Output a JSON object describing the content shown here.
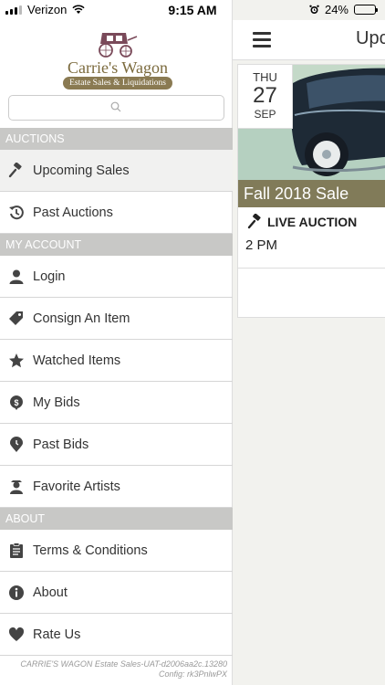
{
  "status_bar": {
    "carrier": "Verizon",
    "time": "9:15 AM",
    "battery": "24%",
    "battery_level": 0.24
  },
  "brand": {
    "name": "Carrie's Wagon",
    "tagline": "Estate Sales & Liquidations"
  },
  "search": {
    "placeholder": ""
  },
  "menu": {
    "sections": [
      {
        "label": "AUCTIONS",
        "items": [
          {
            "label": "Upcoming Sales",
            "icon": "gavel-icon",
            "active": true
          },
          {
            "label": "Past Auctions",
            "icon": "history-icon"
          }
        ]
      },
      {
        "label": "MY ACCOUNT",
        "items": [
          {
            "label": "Login",
            "icon": "user-icon"
          },
          {
            "label": "Consign An Item",
            "icon": "tag-icon"
          },
          {
            "label": "Watched Items",
            "icon": "star-icon"
          },
          {
            "label": "My Bids",
            "icon": "dollar-icon"
          },
          {
            "label": "Past Bids",
            "icon": "map-pin-icon"
          },
          {
            "label": "Favorite Artists",
            "icon": "artist-icon"
          }
        ]
      },
      {
        "label": "ABOUT",
        "items": [
          {
            "label": "Terms & Conditions",
            "icon": "clipboard-icon"
          },
          {
            "label": "About",
            "icon": "info-icon"
          },
          {
            "label": "Rate Us",
            "icon": "heart-icon"
          }
        ]
      }
    ]
  },
  "footer": {
    "line1": "CARRIE'S WAGON Estate Sales-UAT-d2006aa2c.13280",
    "line2": "Config: rk3PnlwPX"
  },
  "main": {
    "title": "Upc",
    "sale": {
      "dow": "THU",
      "day": "27",
      "month": "SEP",
      "name": "Fall 2018 Sale",
      "type": "LIVE AUCTION",
      "time": "2 PM"
    }
  }
}
